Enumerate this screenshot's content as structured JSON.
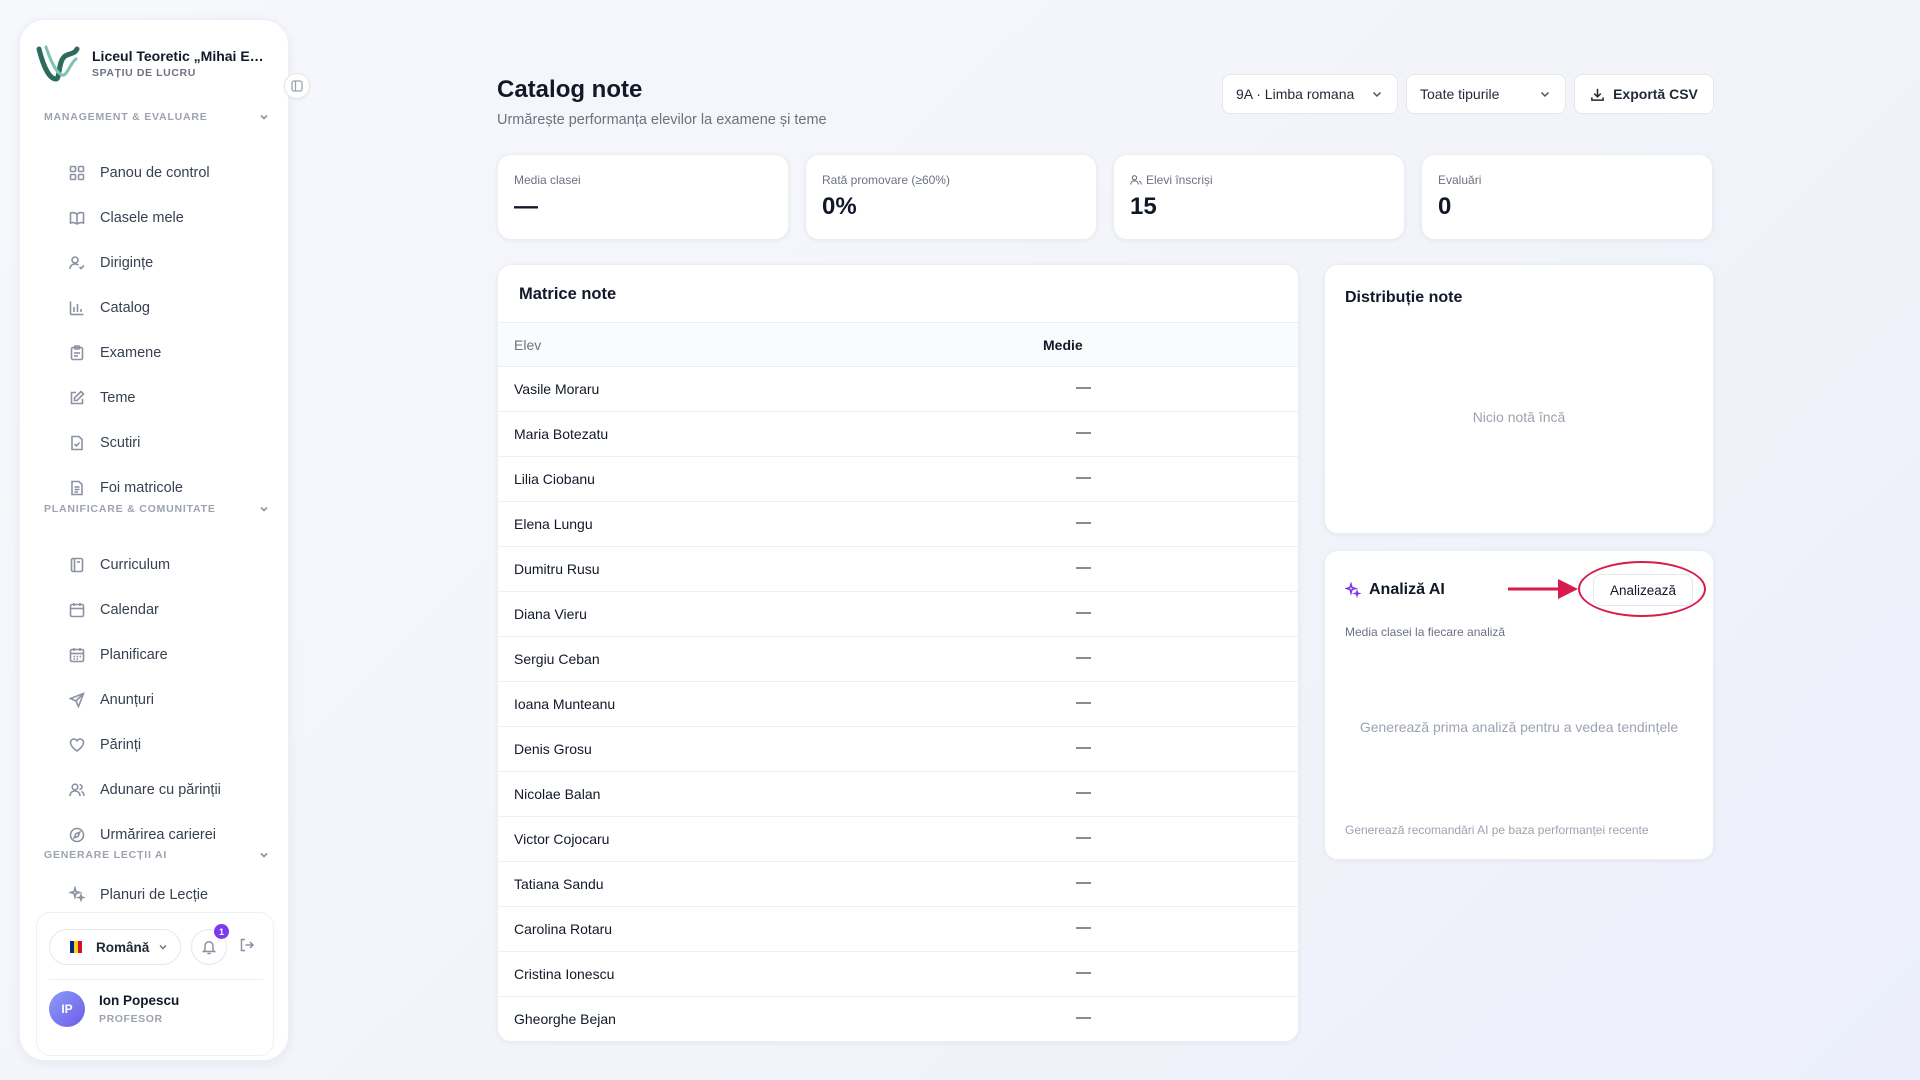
{
  "sidebar": {
    "brand_name": "Liceul Teoretic „Mihai Emi...",
    "brand_sub": "SPAȚIU DE LUCRU",
    "sections": [
      {
        "title": "MANAGEMENT & EVALUARE"
      },
      {
        "title": "PLANIFICARE & COMUNITATE"
      },
      {
        "title": "GENERARE LECȚII AI"
      }
    ],
    "items": [
      {
        "label": "Panou de control",
        "icon": "grid-icon"
      },
      {
        "label": "Clasele mele",
        "icon": "book-open-icon"
      },
      {
        "label": "Dirigințe",
        "icon": "user-check-icon"
      },
      {
        "label": "Catalog",
        "icon": "bar-chart-icon"
      },
      {
        "label": "Examene",
        "icon": "clipboard-icon"
      },
      {
        "label": "Teme",
        "icon": "edit-icon"
      },
      {
        "label": "Scutiri",
        "icon": "file-check-icon"
      },
      {
        "label": "Foi matricole",
        "icon": "file-text-icon"
      },
      {
        "label": "Curriculum",
        "icon": "book-icon"
      },
      {
        "label": "Calendar",
        "icon": "calendar-icon"
      },
      {
        "label": "Planificare",
        "icon": "calendar-grid-icon"
      },
      {
        "label": "Anunțuri",
        "icon": "send-icon"
      },
      {
        "label": "Părinți",
        "icon": "heart-icon"
      },
      {
        "label": "Adunare cu părinții",
        "icon": "users-icon"
      },
      {
        "label": "Urmărirea carierei",
        "icon": "compass-icon"
      },
      {
        "label": "Planuri de Lecție",
        "icon": "sparkles-icon"
      }
    ],
    "language": "Română",
    "notifications_count": "1",
    "user": {
      "initials": "IP",
      "name": "Ion Popescu",
      "role": "PROFESOR"
    }
  },
  "header": {
    "title": "Catalog note",
    "subtitle": "Urmărește performanța elevilor la examene și teme",
    "class_select": "9A · Limba romana",
    "type_select": "Toate tipurile",
    "export_label": "Exportă CSV"
  },
  "stats": [
    {
      "label": "Media clasei",
      "value": "—"
    },
    {
      "label": "Rată promovare (≥60%)",
      "value": "0%"
    },
    {
      "label": "Elevi înscriși",
      "value": "15"
    },
    {
      "label": "Evaluări",
      "value": "0"
    }
  ],
  "matrix": {
    "title": "Matrice note",
    "col_student": "Elev",
    "col_avg": "Medie",
    "rows": [
      {
        "name": "Vasile Moraru",
        "avg": "—"
      },
      {
        "name": "Maria Botezatu",
        "avg": "—"
      },
      {
        "name": "Lilia Ciobanu",
        "avg": "—"
      },
      {
        "name": "Elena Lungu",
        "avg": "—"
      },
      {
        "name": "Dumitru Rusu",
        "avg": "—"
      },
      {
        "name": "Diana Vieru",
        "avg": "—"
      },
      {
        "name": "Sergiu Ceban",
        "avg": "—"
      },
      {
        "name": "Ioana Munteanu",
        "avg": "—"
      },
      {
        "name": "Denis Grosu",
        "avg": "—"
      },
      {
        "name": "Nicolae Balan",
        "avg": "—"
      },
      {
        "name": "Victor Cojocaru",
        "avg": "—"
      },
      {
        "name": "Tatiana Sandu",
        "avg": "—"
      },
      {
        "name": "Carolina Rotaru",
        "avg": "—"
      },
      {
        "name": "Cristina Ionescu",
        "avg": "—"
      },
      {
        "name": "Gheorghe Bejan",
        "avg": "—"
      }
    ]
  },
  "distribution": {
    "title": "Distribuție note",
    "empty": "Nicio notă încă"
  },
  "ai": {
    "title": "Analiză AI",
    "button": "Analizează",
    "subtitle": "Media clasei la fiecare analiză",
    "empty": "Generează prima analiză pentru a vedea tendințele",
    "footer": "Generează recomandări AI pe baza performanței recente"
  },
  "colors": {
    "accent": "#7c3aed",
    "annotation": "#d81b4a",
    "brand_green": "#2f6b5c"
  }
}
